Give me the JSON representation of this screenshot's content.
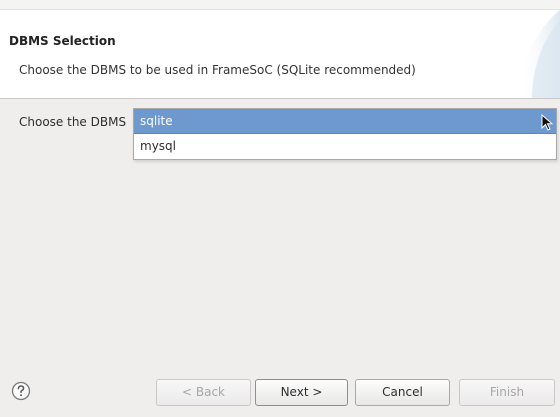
{
  "header": {
    "title": "DBMS Selection",
    "description": "Choose the DBMS to be used in FrameSoC (SQLite recommended)"
  },
  "form": {
    "label": "Choose the DBMS",
    "dropdown": {
      "selected": "sqlite",
      "options": [
        "sqlite",
        "mysql"
      ]
    }
  },
  "footer": {
    "help_icon": "question-circle-icon",
    "buttons": {
      "back": "< Back",
      "next": "Next >",
      "cancel": "Cancel",
      "finish": "Finish"
    }
  },
  "colors": {
    "selection_highlight": "#6e99cf",
    "dialog_background": "#efeeed",
    "header_background": "#ffffff"
  }
}
